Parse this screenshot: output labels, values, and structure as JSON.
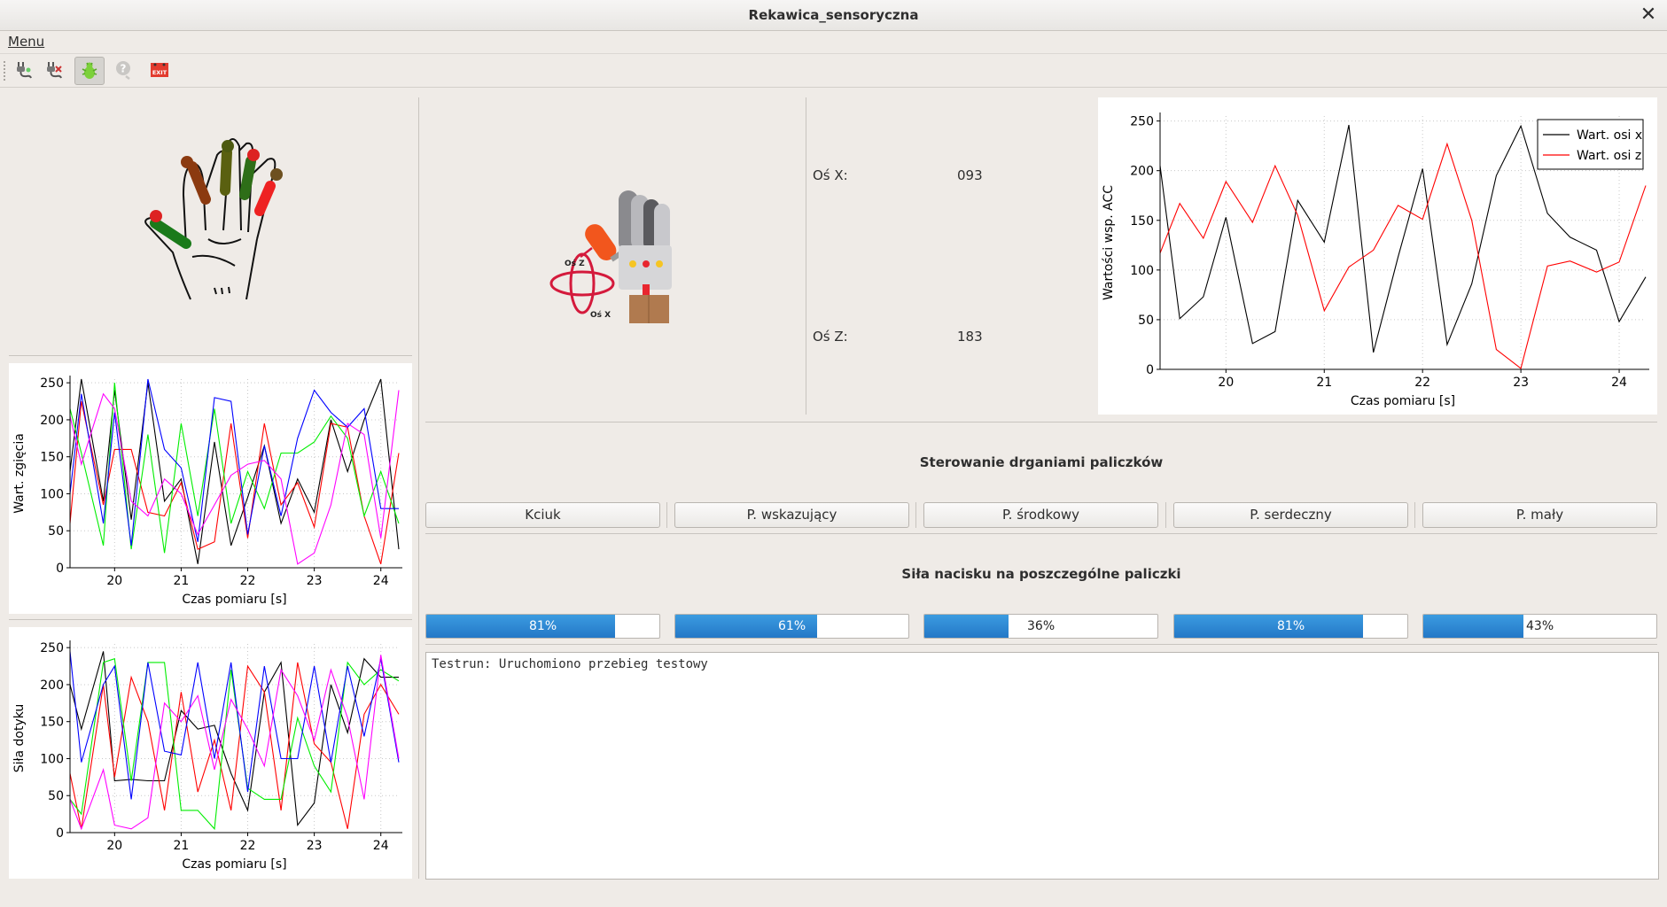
{
  "window": {
    "title": "Rekawica_sensoryczna"
  },
  "menubar": {
    "menu_label": "Menu"
  },
  "toolbar": {
    "icons": [
      "connect-icon",
      "disconnect-icon",
      "bug-icon",
      "help-icon",
      "exit-icon"
    ],
    "exit_label": "EXIT"
  },
  "glove": {
    "accel_axes": {
      "z_label": "Oś Z",
      "x_label": "Oś X"
    }
  },
  "readouts": {
    "x_label": "Oś X:",
    "x_value": "093",
    "z_label": "Oś Z:",
    "z_value": "183"
  },
  "vibration": {
    "heading": "Sterowanie drganiami paliczków",
    "buttons": [
      "Kciuk",
      "P. wskazujący",
      "P. środkowy",
      "P. serdeczny",
      "P. mały"
    ]
  },
  "pressure": {
    "heading": "Siła nacisku na poszczególne paliczki",
    "values": [
      81,
      61,
      36,
      81,
      43
    ],
    "labels": [
      "81%",
      "61%",
      "36%",
      "81%",
      "43%"
    ]
  },
  "log": {
    "text": "Testrun: Uruchomiono przebieg testowy"
  },
  "colors": {
    "bar_fill": "#2a85d4",
    "series": [
      "#000000",
      "#ff0000",
      "#00ee00",
      "#0000ff",
      "#ff00ff"
    ]
  },
  "chart_data": [
    {
      "id": "acc",
      "type": "line",
      "title": "",
      "xlabel": "Czas pomiaru [s]",
      "ylabel": "Wartości wsp. ACC",
      "xlim": [
        19.33,
        24.27
      ],
      "ylim": [
        0,
        255
      ],
      "xticks": [
        20,
        21,
        22,
        23,
        24
      ],
      "yticks": [
        0,
        50,
        100,
        150,
        200,
        250
      ],
      "grid": true,
      "legend": "top-right",
      "series": [
        {
          "name": "Wart. osi x",
          "color": "#000000",
          "x": [
            19.33,
            19.53,
            19.77,
            20.0,
            20.27,
            20.5,
            20.73,
            21.0,
            21.25,
            21.5,
            21.75,
            22.0,
            22.25,
            22.5,
            22.75,
            23.0,
            23.27,
            23.5,
            23.77,
            24.0,
            24.27
          ],
          "y": [
            205,
            51,
            73,
            153,
            26,
            38,
            170,
            128,
            246,
            17,
            113,
            202,
            25,
            86,
            195,
            245,
            157,
            133,
            120,
            48,
            93
          ]
        },
        {
          "name": "Wart. osi z",
          "color": "#ff0000",
          "x": [
            19.33,
            19.53,
            19.77,
            20.0,
            20.27,
            20.5,
            20.73,
            21.0,
            21.25,
            21.5,
            21.75,
            22.0,
            22.25,
            22.5,
            22.75,
            23.0,
            23.27,
            23.5,
            23.77,
            24.0,
            24.27
          ],
          "y": [
            117,
            167,
            132,
            189,
            148,
            205,
            155,
            59,
            103,
            120,
            165,
            151,
            227,
            150,
            20,
            1,
            104,
            109,
            98,
            108,
            185
          ]
        }
      ]
    },
    {
      "id": "bend",
      "type": "line",
      "title": "",
      "xlabel": "Czas pomiaru [s]",
      "ylabel": "Wart. zgięcia",
      "xlim": [
        19.33,
        24.27
      ],
      "ylim": [
        0,
        255
      ],
      "xticks": [
        20,
        21,
        22,
        23,
        24
      ],
      "yticks": [
        0,
        50,
        100,
        150,
        200,
        250
      ],
      "grid": true,
      "series": [
        {
          "color": "#000000",
          "x": [
            19.33,
            19.5,
            19.83,
            20.0,
            20.25,
            20.5,
            20.75,
            21.0,
            21.25,
            21.5,
            21.75,
            22.0,
            22.25,
            22.5,
            22.75,
            23.0,
            23.25,
            23.5,
            23.75,
            24.0,
            24.27
          ],
          "y": [
            130,
            255,
            90,
            240,
            65,
            250,
            90,
            120,
            5,
            170,
            30,
            95,
            165,
            60,
            120,
            75,
            200,
            130,
            200,
            255,
            25
          ]
        },
        {
          "color": "#ff0000",
          "x": [
            19.33,
            19.5,
            19.83,
            20.0,
            20.25,
            20.5,
            20.75,
            21.0,
            21.25,
            21.5,
            21.75,
            22.0,
            22.25,
            22.5,
            22.75,
            23.0,
            23.25,
            23.5,
            23.75,
            24.0,
            24.27
          ],
          "y": [
            60,
            225,
            85,
            160,
            160,
            75,
            70,
            115,
            25,
            35,
            195,
            40,
            195,
            85,
            115,
            55,
            195,
            190,
            70,
            5,
            155
          ]
        },
        {
          "color": "#00ee00",
          "x": [
            19.33,
            19.5,
            19.83,
            20.0,
            20.25,
            20.5,
            20.75,
            21.0,
            21.25,
            21.5,
            21.75,
            22.0,
            22.25,
            22.5,
            22.75,
            23.0,
            23.25,
            23.5,
            23.75,
            24.0,
            24.27
          ],
          "y": [
            215,
            155,
            30,
            250,
            25,
            180,
            20,
            195,
            70,
            215,
            60,
            130,
            80,
            155,
            155,
            170,
            205,
            175,
            70,
            130,
            60
          ]
        },
        {
          "color": "#0000ff",
          "x": [
            19.33,
            19.5,
            19.83,
            20.0,
            20.25,
            20.5,
            20.75,
            21.0,
            21.25,
            21.5,
            21.75,
            22.0,
            22.25,
            22.5,
            22.75,
            23.0,
            23.25,
            23.5,
            23.75,
            24.0,
            24.27
          ],
          "y": [
            100,
            235,
            60,
            210,
            30,
            255,
            160,
            135,
            35,
            230,
            225,
            45,
            165,
            70,
            175,
            240,
            210,
            190,
            215,
            80,
            80
          ]
        },
        {
          "color": "#ff00ff",
          "x": [
            19.33,
            19.5,
            19.83,
            20.0,
            20.25,
            20.5,
            20.75,
            21.0,
            21.25,
            21.5,
            21.75,
            22.0,
            22.25,
            22.5,
            22.75,
            23.0,
            23.25,
            23.5,
            23.75,
            24.0,
            24.27
          ],
          "y": [
            205,
            140,
            235,
            215,
            90,
            70,
            120,
            100,
            45,
            85,
            125,
            140,
            145,
            120,
            5,
            20,
            85,
            195,
            180,
            40,
            240
          ]
        }
      ]
    },
    {
      "id": "touch",
      "type": "line",
      "title": "",
      "xlabel": "Czas pomiaru [s]",
      "ylabel": "Siła dotyku",
      "xlim": [
        19.33,
        24.27
      ],
      "ylim": [
        0,
        255
      ],
      "xticks": [
        20,
        21,
        22,
        23,
        24
      ],
      "yticks": [
        0,
        50,
        100,
        150,
        200,
        250
      ],
      "grid": true,
      "series": [
        {
          "color": "#000000",
          "x": [
            19.33,
            19.5,
            19.83,
            20.0,
            20.25,
            20.5,
            20.75,
            21.0,
            21.25,
            21.5,
            21.75,
            22.0,
            22.25,
            22.5,
            22.75,
            23.0,
            23.25,
            23.5,
            23.75,
            24.0,
            24.27
          ],
          "y": [
            200,
            140,
            245,
            70,
            72,
            70,
            70,
            165,
            140,
            145,
            80,
            30,
            190,
            230,
            10,
            40,
            200,
            135,
            235,
            210,
            210
          ]
        },
        {
          "color": "#ff0000",
          "x": [
            19.33,
            19.5,
            19.83,
            20.0,
            20.25,
            20.5,
            20.75,
            21.0,
            21.25,
            21.5,
            21.75,
            22.0,
            22.25,
            22.5,
            22.75,
            23.0,
            23.25,
            23.5,
            23.75,
            24.0,
            24.27
          ],
          "y": [
            80,
            5,
            200,
            75,
            210,
            150,
            30,
            190,
            55,
            125,
            30,
            225,
            190,
            30,
            230,
            120,
            95,
            5,
            160,
            200,
            160
          ]
        },
        {
          "color": "#00ee00",
          "x": [
            19.33,
            19.5,
            19.83,
            20.0,
            20.25,
            20.5,
            20.75,
            21.0,
            21.25,
            21.5,
            21.75,
            22.0,
            22.25,
            22.5,
            22.75,
            23.0,
            23.25,
            23.5,
            23.75,
            24.0,
            24.27
          ],
          "y": [
            45,
            25,
            230,
            235,
            70,
            230,
            230,
            30,
            30,
            5,
            220,
            60,
            45,
            45,
            155,
            90,
            55,
            230,
            200,
            220,
            205
          ]
        },
        {
          "color": "#0000ff",
          "x": [
            19.33,
            19.5,
            19.83,
            20.0,
            20.25,
            20.5,
            20.75,
            21.0,
            21.25,
            21.5,
            21.75,
            22.0,
            22.25,
            22.5,
            22.75,
            23.0,
            23.25,
            23.5,
            23.75,
            24.0,
            24.27
          ],
          "y": [
            245,
            95,
            200,
            225,
            45,
            230,
            110,
            105,
            230,
            100,
            230,
            55,
            225,
            100,
            100,
            225,
            95,
            225,
            130,
            235,
            95
          ]
        },
        {
          "color": "#ff00ff",
          "x": [
            19.33,
            19.5,
            19.83,
            20.0,
            20.25,
            20.5,
            20.75,
            21.0,
            21.25,
            21.5,
            21.75,
            22.0,
            22.25,
            22.5,
            22.75,
            23.0,
            23.25,
            23.5,
            23.75,
            24.0,
            24.27
          ],
          "y": [
            45,
            5,
            85,
            10,
            5,
            20,
            175,
            150,
            185,
            85,
            180,
            140,
            90,
            220,
            185,
            125,
            220,
            155,
            45,
            240,
            100
          ]
        }
      ]
    }
  ]
}
